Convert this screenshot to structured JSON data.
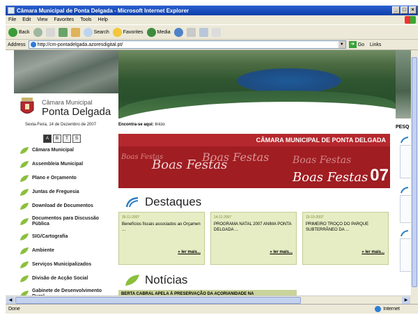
{
  "window": {
    "title": "Câmara Municipal de Ponta Delgada - Microsoft Internet Explorer",
    "controls": [
      "_",
      "□",
      "×"
    ]
  },
  "menu": [
    "File",
    "Edit",
    "View",
    "Favorites",
    "Tools",
    "Help"
  ],
  "toolbar": {
    "back": "Back",
    "search": "Search",
    "favorites": "Favorites",
    "media": "Media"
  },
  "address": {
    "label": "Address",
    "url": "http://cm-pontadelgada.azoresdigital.pt/",
    "go": "Go",
    "links": "Links"
  },
  "site": {
    "brand_small": "Câmara Municipal",
    "brand_big": "Ponta Delgada",
    "date": "Sexta-Feira, 14 de Dezembro de 2007",
    "breadcrumb_label": "Encontra-se aqui:",
    "breadcrumb_value": "Início",
    "tools": [
      "A",
      "B",
      "T",
      "S"
    ],
    "nav": [
      "Câmara Municipal",
      "Assembleia Municipal",
      "Plano e Orçamento",
      "Juntas de Freguesia",
      "Download de Documentos",
      "Documentos para Discussão Pública",
      "SIG/Cartografia",
      "Ambiente",
      "Serviços Municipalizados",
      "Divisão de Acção Social",
      "Gabinete de Desenvolvimento Rural"
    ],
    "promo": {
      "title": "CÂMARA MUNICIPAL DE PONTA DELGADA",
      "script1": "Boas Festas",
      "script2": "Boas Festas",
      "script3": "Boas Festas",
      "script4": "Boas Festas",
      "script5": "Boas Festas",
      "year": "07"
    },
    "destaques_title": "Destaques",
    "cards": [
      {
        "date": "26-11-2007",
        "text": "Benefícios fiscais associados ao Orçamen ...",
        "more": "» ler mais..."
      },
      {
        "date": "14-11-2007",
        "text": "PROGRAMA NATAL 2007 ANIMA PONTA DELGADA ...",
        "more": "» ler mais..."
      },
      {
        "date": "15-10-2007",
        "text": "PRIMEIRO TROÇO DO PARQUE SUBTERRÂNEO DA ...",
        "more": "» ler mais..."
      }
    ],
    "noticias_title": "Notícias",
    "news_headline": "BERTA CABRAL APELA À PRESERVAÇÃO DA AÇORIANIDADE NA",
    "right_label": "PESQ"
  },
  "status": {
    "text": "Done",
    "zone": "Internet"
  },
  "colors": {
    "accent_red": "#b5282d",
    "card_green": "#e6edc4",
    "leaf_green": "#8bbf3c",
    "badge_blue": "#2f7fc1"
  }
}
